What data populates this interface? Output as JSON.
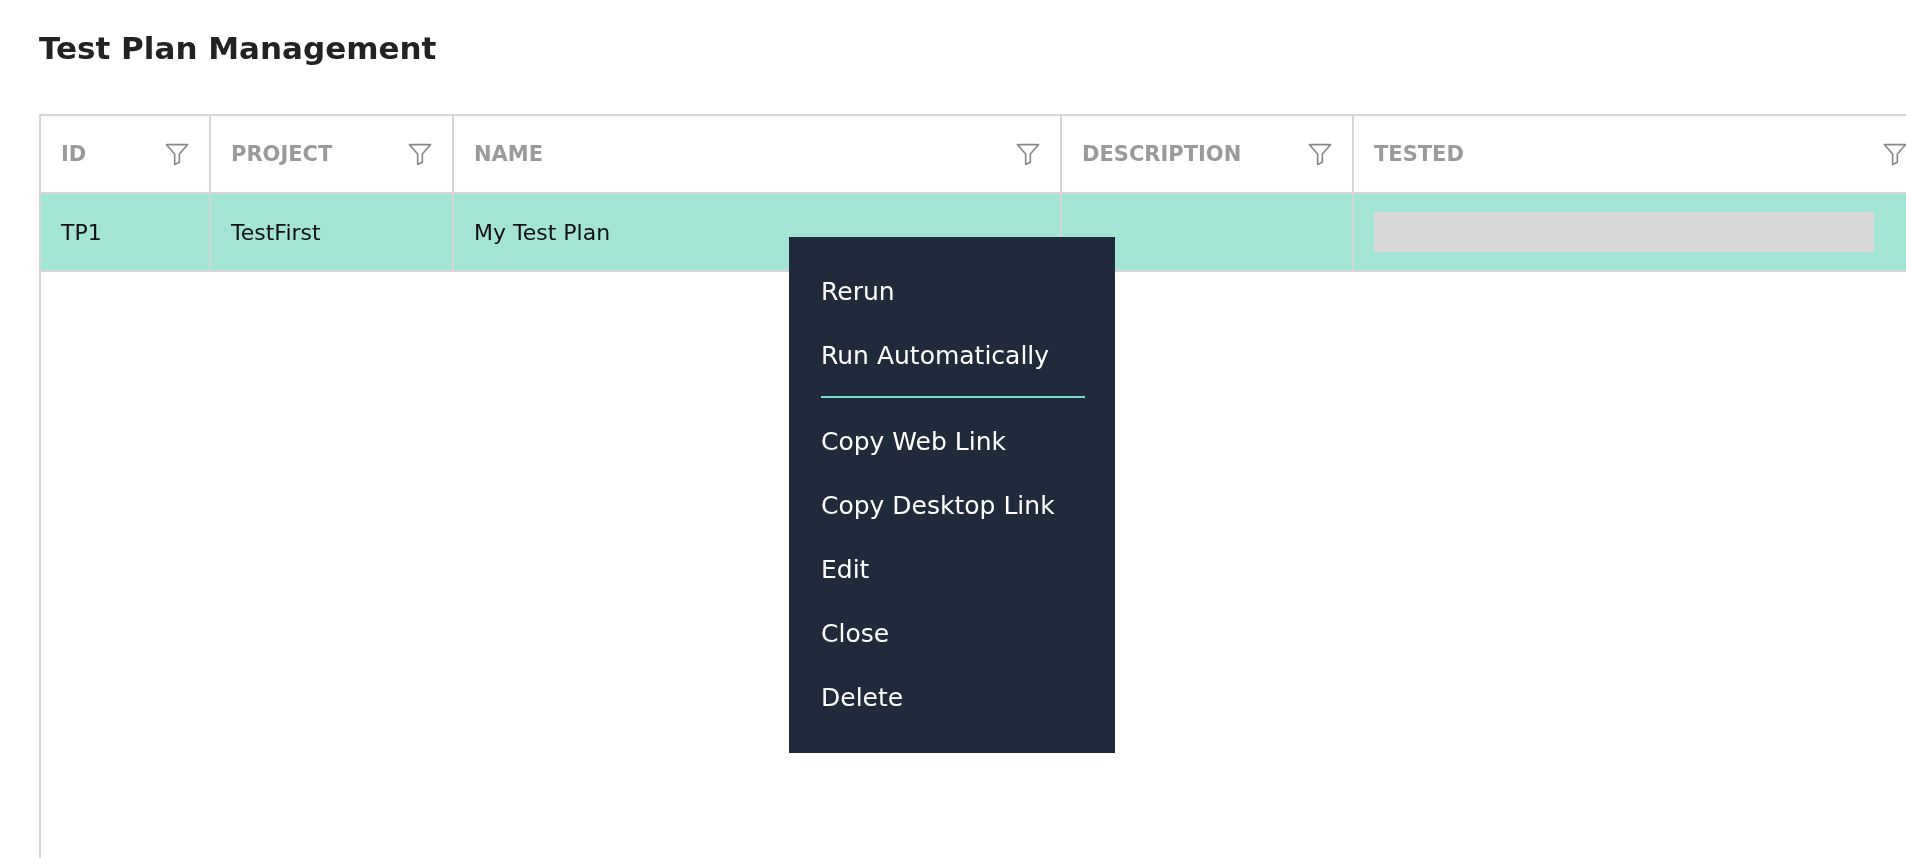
{
  "title": "Test Plan Management",
  "table": {
    "columns": [
      {
        "label": "ID"
      },
      {
        "label": "PROJECT"
      },
      {
        "label": "NAME"
      },
      {
        "label": "DESCRIPTION"
      },
      {
        "label": "TESTED"
      }
    ],
    "rows": [
      {
        "selected": true,
        "id": "TP1",
        "project": "TestFirst",
        "name": "My Test Plan"
      }
    ]
  },
  "context_menu": {
    "items": [
      {
        "kind": "item",
        "label": "Rerun"
      },
      {
        "kind": "item",
        "label": "Run Automatically"
      },
      {
        "kind": "separator"
      },
      {
        "kind": "item",
        "label": "Copy Web Link"
      },
      {
        "kind": "item",
        "label": "Copy Desktop Link"
      },
      {
        "kind": "item",
        "label": "Edit"
      },
      {
        "kind": "item",
        "label": "Close"
      },
      {
        "kind": "item",
        "label": "Delete"
      }
    ]
  }
}
